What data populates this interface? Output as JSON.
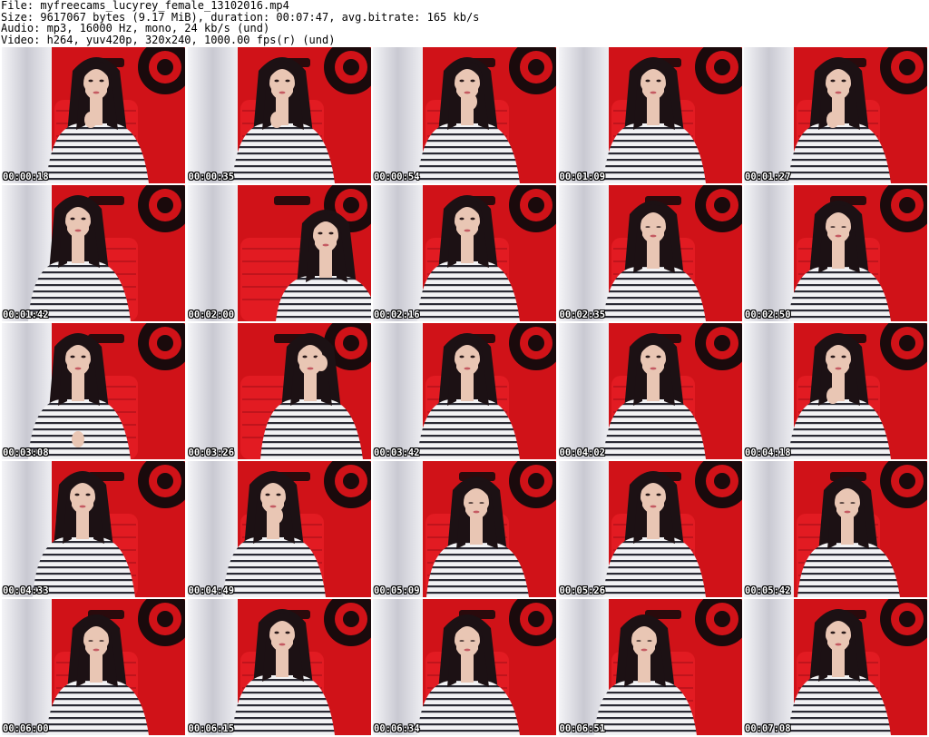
{
  "header": {
    "file_line": "File: myfreecams_lucyrey_female_13102016.mp4",
    "size_line": "Size: 9617067 bytes (9.17 MiB), duration: 00:07:47, avg.bitrate: 165 kb/s",
    "audio_line": "Audio: mp3, 16000 Hz, mono, 24 kb/s (und)",
    "video_line": "Video: h264, yuv420p, 320x240, 1000.00 fps(r) (und)"
  },
  "colors": {
    "wall_red": "#d01218",
    "curtain_white": "#e9e9ee",
    "hair_dark": "#1c1114",
    "skin": "#e9c6b4",
    "shirt_white": "#f2f2f4",
    "shirt_stripe": "#2a2a34",
    "chair_red": "#e21b22"
  },
  "thumbnails": [
    {
      "time": "00:00:18",
      "pose": "front",
      "hand": "chest",
      "shift": 0
    },
    {
      "time": "00:00:35",
      "pose": "front",
      "hand": "chest",
      "shift": 0
    },
    {
      "time": "00:00:54",
      "pose": "front",
      "hand": "chin",
      "shift": 0
    },
    {
      "time": "00:01:09",
      "pose": "front",
      "hand": "none",
      "shift": 0
    },
    {
      "time": "00:01:27",
      "pose": "front",
      "hand": "chest",
      "shift": 0
    },
    {
      "time": "00:01:42",
      "pose": "front",
      "hand": "none",
      "shift": -20
    },
    {
      "time": "00:02:00",
      "pose": "lean-down",
      "hand": "none",
      "shift": 40
    },
    {
      "time": "00:02:16",
      "pose": "front",
      "hand": "none",
      "shift": 0
    },
    {
      "time": "00:02:35",
      "pose": "down",
      "hand": "none",
      "shift": 0
    },
    {
      "time": "00:02:50",
      "pose": "down",
      "hand": "none",
      "shift": 0
    },
    {
      "time": "00:03:08",
      "pose": "front",
      "hand": "lap",
      "shift": -20
    },
    {
      "time": "00:03:26",
      "pose": "tilt",
      "hand": "face",
      "shift": 25
    },
    {
      "time": "00:03:42",
      "pose": "front",
      "hand": "none",
      "shift": 0
    },
    {
      "time": "00:04:02",
      "pose": "front",
      "hand": "none",
      "shift": 0
    },
    {
      "time": "00:04:18",
      "pose": "front",
      "hand": "chest",
      "shift": 0
    },
    {
      "time": "00:04:33",
      "pose": "front",
      "hand": "none",
      "shift": -15
    },
    {
      "time": "00:04:49",
      "pose": "front",
      "hand": "chin",
      "shift": -10
    },
    {
      "time": "00:05:09",
      "pose": "down",
      "hand": "none",
      "shift": 10
    },
    {
      "time": "00:05:26",
      "pose": "front",
      "hand": "none",
      "shift": 0
    },
    {
      "time": "00:05:42",
      "pose": "down",
      "hand": "none",
      "shift": 10
    },
    {
      "time": "00:06:00",
      "pose": "down",
      "hand": "none",
      "shift": 0
    },
    {
      "time": "00:06:15",
      "pose": "front",
      "hand": "none",
      "shift": 0
    },
    {
      "time": "00:06:34",
      "pose": "down",
      "hand": "none",
      "shift": 0
    },
    {
      "time": "00:06:51",
      "pose": "down",
      "hand": "none",
      "shift": -10
    },
    {
      "time": "00:07:08",
      "pose": "front",
      "hand": "none",
      "shift": 0
    }
  ]
}
